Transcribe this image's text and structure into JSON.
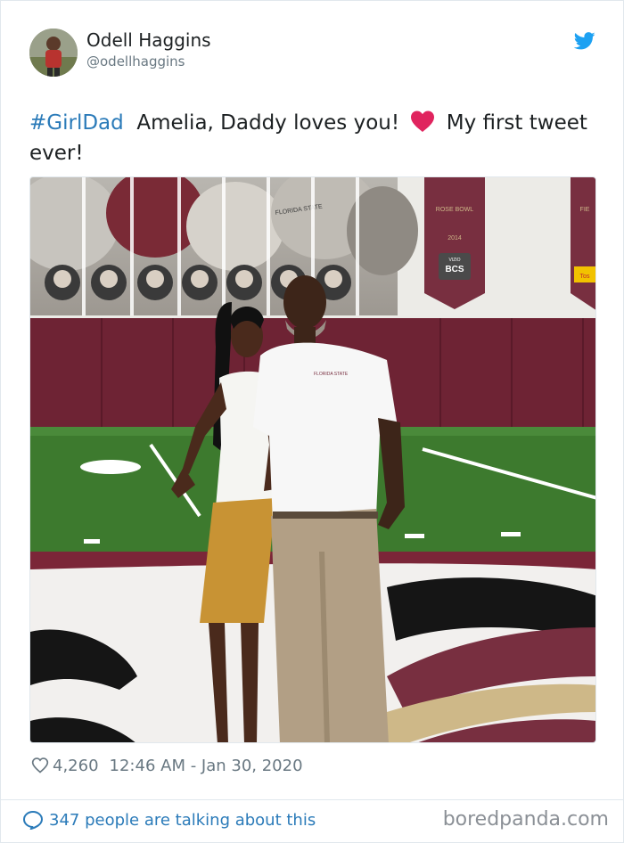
{
  "user": {
    "display_name": "Odell Haggins",
    "handle": "@odellhaggins"
  },
  "tweet": {
    "hashtag": "#GirlDad",
    "text_before_emoji": "Amelia, Daddy loves you!",
    "text_after_emoji": "My first tweet ever!"
  },
  "photo": {
    "banner_rose_bowl": "ROSE BOWL",
    "banner_year": "2014",
    "banner_bcs": "BCS",
    "banner_vizio": "VIZIO",
    "banner_fiesta": "FIE",
    "wall_text": "FLORIDA STATE",
    "shirt_text": "FLORIDA STATE",
    "tostitos": "Tos"
  },
  "meta": {
    "likes": "4,260",
    "timestamp": "12:46 AM - Jan 30, 2020"
  },
  "footer": {
    "talking": "347 people are talking about this",
    "watermark": "boredpanda.com"
  },
  "colors": {
    "link": "#2b7bb9",
    "garnet": "#782f40",
    "gold": "#ceb888",
    "turf": "#3d7a2e"
  },
  "icons": [
    "twitter-bird-icon",
    "heart-emoji-icon",
    "heart-outline-icon",
    "speech-bubble-icon"
  ]
}
